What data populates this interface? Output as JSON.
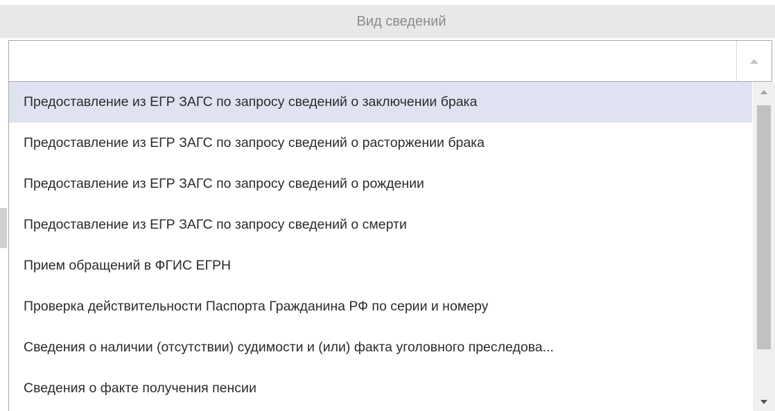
{
  "header": {
    "title": "Вид сведений"
  },
  "select": {
    "value": "",
    "arrow_icon": "caret-up-icon"
  },
  "dropdown": {
    "selected_index": 0,
    "items": [
      {
        "label": "Предоставление из ЕГР ЗАГС по запросу сведений о заключении брака"
      },
      {
        "label": "Предоставление из ЕГР ЗАГС по запросу сведений о расторжении брака"
      },
      {
        "label": "Предоставление из ЕГР ЗАГС по запросу сведений о рождении"
      },
      {
        "label": "Предоставление из ЕГР ЗАГС по запросу сведений о смерти"
      },
      {
        "label": "Прием обращений в ФГИС ЕГРН"
      },
      {
        "label": "Проверка действительности Паспорта Гражданина РФ по серии и номеру"
      },
      {
        "label": "Сведения о наличии (отсутствии) судимости и (или) факта уголовного преследова..."
      },
      {
        "label": "Сведения о факте получения пенсии"
      }
    ]
  },
  "scrollbar": {
    "up_icon": "scroll-up-arrow-icon",
    "down_icon": "scroll-down-arrow-icon"
  },
  "colors": {
    "header_bg": "#e8e8e8",
    "header_text": "#8a8a8a",
    "selected_bg": "#dfe3f1",
    "border": "#a9a9a9",
    "text": "#2b2b2b"
  }
}
